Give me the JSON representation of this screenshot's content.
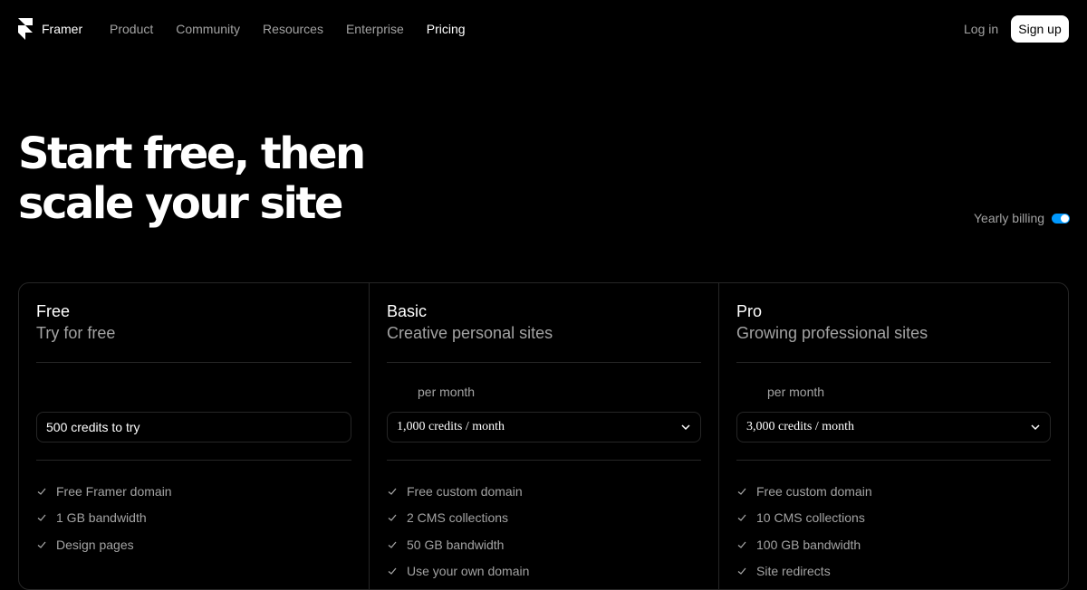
{
  "nav": {
    "brand": "Framer",
    "links": [
      "Product",
      "Community",
      "Resources",
      "Enterprise",
      "Pricing"
    ],
    "active": "Pricing",
    "login": "Log in",
    "signup": "Sign up"
  },
  "hero": {
    "line1": "Start free, then",
    "line2": "scale your site"
  },
  "billing": {
    "label": "Yearly billing",
    "enabled": true,
    "accent": "#0099ff"
  },
  "plans": [
    {
      "name": "Free",
      "description": "Try for free",
      "price_note": "",
      "credits": "500 credits to try",
      "features": [
        "Free Framer domain",
        "1 GB bandwidth",
        "Design pages"
      ]
    },
    {
      "name": "Basic",
      "description": "Creative personal sites",
      "price_note": "per month",
      "credits": "1,000 credits / month",
      "features": [
        "Free custom domain",
        "2 CMS collections",
        "50 GB bandwidth",
        "Use your own domain"
      ]
    },
    {
      "name": "Pro",
      "description": "Growing professional sites",
      "price_note": "per month",
      "credits": "3,000 credits / month",
      "features": [
        "Free custom domain",
        "10 CMS collections",
        "100 GB bandwidth",
        "Site redirects"
      ]
    }
  ]
}
